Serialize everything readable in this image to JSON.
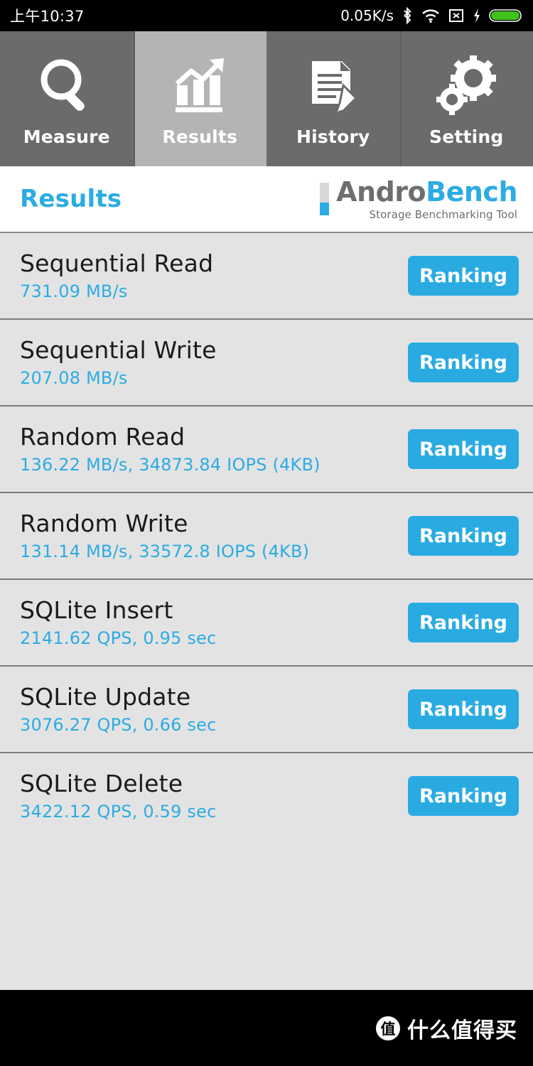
{
  "statusbar": {
    "clock": "上午10:37",
    "network_speed": "0.05K/s",
    "icons": [
      "bluetooth-icon",
      "wifi-icon",
      "no-sim-icon",
      "charging-bolt-icon",
      "battery-icon"
    ],
    "battery_color": "#3FC11A"
  },
  "tabs": [
    {
      "label": "Measure",
      "icon": "magnifier-icon",
      "active": false
    },
    {
      "label": "Results",
      "icon": "bar-chart-arrow-icon",
      "active": true
    },
    {
      "label": "History",
      "icon": "document-pencil-icon",
      "active": false
    },
    {
      "label": "Setting",
      "icon": "gears-icon",
      "active": false
    }
  ],
  "header": {
    "title": "Results",
    "brand_first": "Andro",
    "brand_second": "Bench",
    "brand_tagline": "Storage Benchmarking Tool"
  },
  "colors": {
    "accent_blue": "#29ABE2",
    "tab_inactive": "#6B6B6B",
    "tab_active": "#B4B4B4",
    "list_background": "#E4E3E4",
    "title_text": "#1B1B1B"
  },
  "results": {
    "button_label": "Ranking",
    "rows": [
      {
        "name": "Sequential Read",
        "value": "731.09 MB/s"
      },
      {
        "name": "Sequential Write",
        "value": "207.08 MB/s"
      },
      {
        "name": "Random Read",
        "value": "136.22 MB/s, 34873.84 IOPS (4KB)"
      },
      {
        "name": "Random Write",
        "value": "131.14 MB/s, 33572.8 IOPS (4KB)"
      },
      {
        "name": "SQLite Insert",
        "value": "2141.62 QPS, 0.95 sec"
      },
      {
        "name": "SQLite Update",
        "value": "3076.27 QPS, 0.66 sec"
      },
      {
        "name": "SQLite Delete",
        "value": "3422.12 QPS, 0.59 sec"
      }
    ]
  },
  "watermark": {
    "logo_char": "值",
    "text": "什么值得买"
  }
}
